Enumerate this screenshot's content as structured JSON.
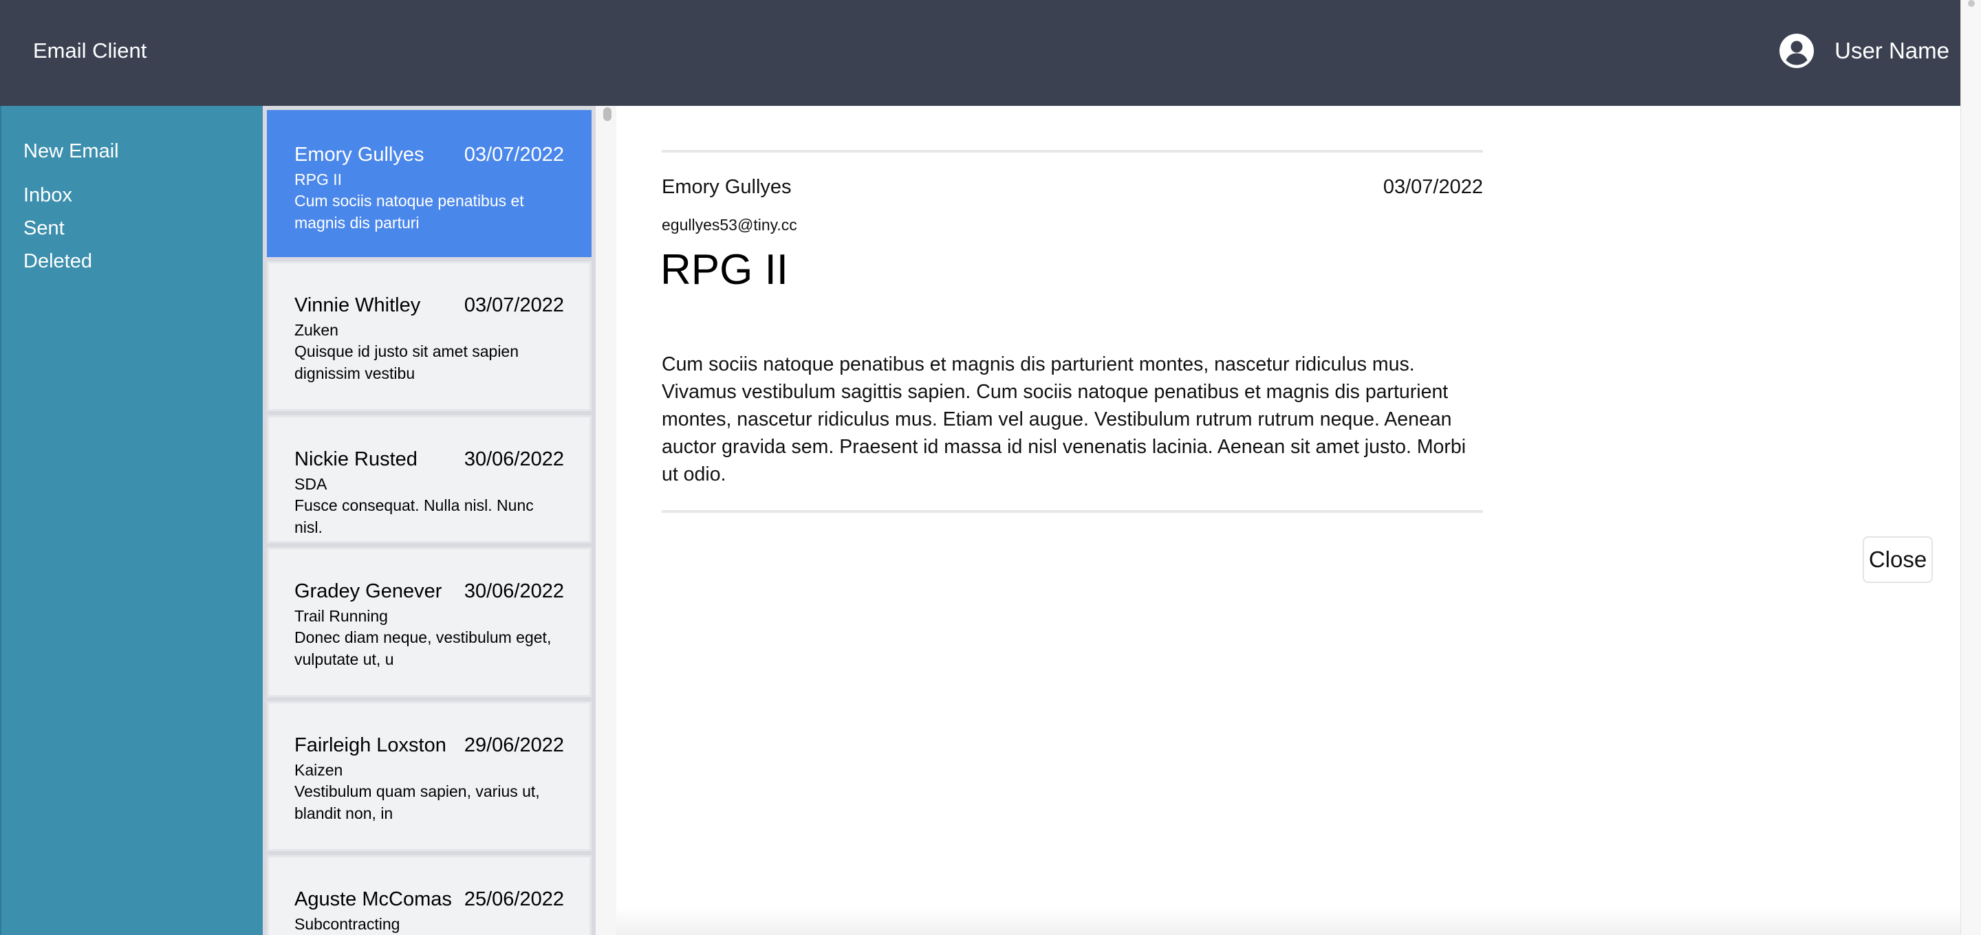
{
  "header": {
    "app_title": "Email Client",
    "user_name": "User Name",
    "user_icon": "account-circle-icon"
  },
  "sidebar": {
    "new_email": "New Email",
    "items": [
      {
        "label": "Inbox"
      },
      {
        "label": "Sent"
      },
      {
        "label": "Deleted"
      }
    ]
  },
  "email_list": {
    "items": [
      {
        "sender": "Emory Gullyes",
        "date": "03/07/2022",
        "subject": "RPG II",
        "preview": "Cum sociis natoque penatibus et magnis dis parturi",
        "selected": true
      },
      {
        "sender": "Vinnie Whitley",
        "date": "03/07/2022",
        "subject": "Zuken",
        "preview": "Quisque id justo sit amet sapien dignissim vestibu",
        "selected": false
      },
      {
        "sender": "Nickie Rusted",
        "date": "30/06/2022",
        "subject": "SDA",
        "preview": "Fusce consequat. Nulla nisl. Nunc nisl.",
        "selected": false
      },
      {
        "sender": "Gradey Genever",
        "date": "30/06/2022",
        "subject": "Trail Running",
        "preview": "Donec diam neque, vestibulum eget, vulputate ut, u",
        "selected": false
      },
      {
        "sender": "Fairleigh Loxston",
        "date": "29/06/2022",
        "subject": "Kaizen",
        "preview": "Vestibulum quam sapien, varius ut, blandit non, in",
        "selected": false
      },
      {
        "sender": "Aguste McComas",
        "date": "25/06/2022",
        "subject": "Subcontracting",
        "preview": "",
        "selected": false
      }
    ]
  },
  "reader": {
    "from_name": "Emory Gullyes",
    "date": "03/07/2022",
    "from_email": "egullyes53@tiny.cc",
    "subject": "RPG II",
    "body": "Cum sociis natoque penatibus et magnis dis parturient montes, nascetur ridiculus mus. Vivamus vestibulum sagittis sapien. Cum sociis natoque penatibus et magnis dis parturient montes, nascetur ridiculus mus. Etiam vel augue. Vestibulum rutrum rutrum neque. Aenean auctor gravida sem. Praesent id massa id nisl venenatis lacinia. Aenean sit amet justo. Morbi ut odio.",
    "close_label": "Close"
  },
  "colors": {
    "header_bg": "#3b4151",
    "sidebar_bg": "#3c8fad",
    "selected_item_bg": "#4a87ea",
    "list_item_bg": "#f1f2f4"
  }
}
